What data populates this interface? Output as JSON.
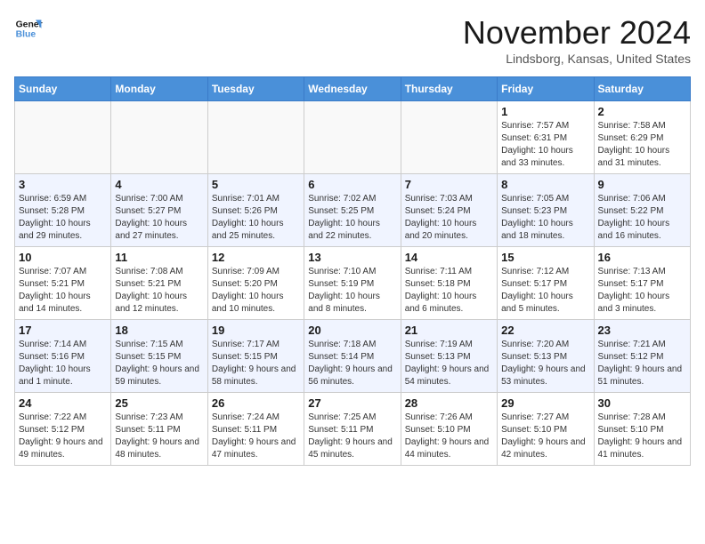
{
  "logo": {
    "line1": "General",
    "line2": "Blue",
    "tagline": "Blue"
  },
  "header": {
    "month": "November 2024",
    "location": "Lindsborg, Kansas, United States"
  },
  "weekdays": [
    "Sunday",
    "Monday",
    "Tuesday",
    "Wednesday",
    "Thursday",
    "Friday",
    "Saturday"
  ],
  "weeks": [
    [
      {
        "day": "",
        "info": ""
      },
      {
        "day": "",
        "info": ""
      },
      {
        "day": "",
        "info": ""
      },
      {
        "day": "",
        "info": ""
      },
      {
        "day": "",
        "info": ""
      },
      {
        "day": "1",
        "info": "Sunrise: 7:57 AM\nSunset: 6:31 PM\nDaylight: 10 hours and 33 minutes."
      },
      {
        "day": "2",
        "info": "Sunrise: 7:58 AM\nSunset: 6:29 PM\nDaylight: 10 hours and 31 minutes."
      }
    ],
    [
      {
        "day": "3",
        "info": "Sunrise: 6:59 AM\nSunset: 5:28 PM\nDaylight: 10 hours and 29 minutes."
      },
      {
        "day": "4",
        "info": "Sunrise: 7:00 AM\nSunset: 5:27 PM\nDaylight: 10 hours and 27 minutes."
      },
      {
        "day": "5",
        "info": "Sunrise: 7:01 AM\nSunset: 5:26 PM\nDaylight: 10 hours and 25 minutes."
      },
      {
        "day": "6",
        "info": "Sunrise: 7:02 AM\nSunset: 5:25 PM\nDaylight: 10 hours and 22 minutes."
      },
      {
        "day": "7",
        "info": "Sunrise: 7:03 AM\nSunset: 5:24 PM\nDaylight: 10 hours and 20 minutes."
      },
      {
        "day": "8",
        "info": "Sunrise: 7:05 AM\nSunset: 5:23 PM\nDaylight: 10 hours and 18 minutes."
      },
      {
        "day": "9",
        "info": "Sunrise: 7:06 AM\nSunset: 5:22 PM\nDaylight: 10 hours and 16 minutes."
      }
    ],
    [
      {
        "day": "10",
        "info": "Sunrise: 7:07 AM\nSunset: 5:21 PM\nDaylight: 10 hours and 14 minutes."
      },
      {
        "day": "11",
        "info": "Sunrise: 7:08 AM\nSunset: 5:21 PM\nDaylight: 10 hours and 12 minutes."
      },
      {
        "day": "12",
        "info": "Sunrise: 7:09 AM\nSunset: 5:20 PM\nDaylight: 10 hours and 10 minutes."
      },
      {
        "day": "13",
        "info": "Sunrise: 7:10 AM\nSunset: 5:19 PM\nDaylight: 10 hours and 8 minutes."
      },
      {
        "day": "14",
        "info": "Sunrise: 7:11 AM\nSunset: 5:18 PM\nDaylight: 10 hours and 6 minutes."
      },
      {
        "day": "15",
        "info": "Sunrise: 7:12 AM\nSunset: 5:17 PM\nDaylight: 10 hours and 5 minutes."
      },
      {
        "day": "16",
        "info": "Sunrise: 7:13 AM\nSunset: 5:17 PM\nDaylight: 10 hours and 3 minutes."
      }
    ],
    [
      {
        "day": "17",
        "info": "Sunrise: 7:14 AM\nSunset: 5:16 PM\nDaylight: 10 hours and 1 minute."
      },
      {
        "day": "18",
        "info": "Sunrise: 7:15 AM\nSunset: 5:15 PM\nDaylight: 9 hours and 59 minutes."
      },
      {
        "day": "19",
        "info": "Sunrise: 7:17 AM\nSunset: 5:15 PM\nDaylight: 9 hours and 58 minutes."
      },
      {
        "day": "20",
        "info": "Sunrise: 7:18 AM\nSunset: 5:14 PM\nDaylight: 9 hours and 56 minutes."
      },
      {
        "day": "21",
        "info": "Sunrise: 7:19 AM\nSunset: 5:13 PM\nDaylight: 9 hours and 54 minutes."
      },
      {
        "day": "22",
        "info": "Sunrise: 7:20 AM\nSunset: 5:13 PM\nDaylight: 9 hours and 53 minutes."
      },
      {
        "day": "23",
        "info": "Sunrise: 7:21 AM\nSunset: 5:12 PM\nDaylight: 9 hours and 51 minutes."
      }
    ],
    [
      {
        "day": "24",
        "info": "Sunrise: 7:22 AM\nSunset: 5:12 PM\nDaylight: 9 hours and 49 minutes."
      },
      {
        "day": "25",
        "info": "Sunrise: 7:23 AM\nSunset: 5:11 PM\nDaylight: 9 hours and 48 minutes."
      },
      {
        "day": "26",
        "info": "Sunrise: 7:24 AM\nSunset: 5:11 PM\nDaylight: 9 hours and 47 minutes."
      },
      {
        "day": "27",
        "info": "Sunrise: 7:25 AM\nSunset: 5:11 PM\nDaylight: 9 hours and 45 minutes."
      },
      {
        "day": "28",
        "info": "Sunrise: 7:26 AM\nSunset: 5:10 PM\nDaylight: 9 hours and 44 minutes."
      },
      {
        "day": "29",
        "info": "Sunrise: 7:27 AM\nSunset: 5:10 PM\nDaylight: 9 hours and 42 minutes."
      },
      {
        "day": "30",
        "info": "Sunrise: 7:28 AM\nSunset: 5:10 PM\nDaylight: 9 hours and 41 minutes."
      }
    ]
  ]
}
